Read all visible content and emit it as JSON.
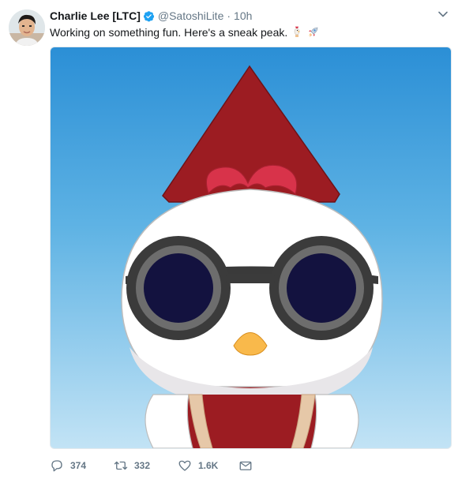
{
  "tweet": {
    "display_name": "Charlie Lee [LTC]",
    "handle": "@SatoshiLite",
    "separator": "·",
    "time": "10h",
    "text": "Working on something fun. Here's a sneak peak.",
    "emojis": [
      "chicken-icon",
      "rocket-icon"
    ]
  },
  "actions": {
    "reply_count": "374",
    "retweet_count": "332",
    "like_count": "1.6K"
  },
  "colors": {
    "verified": "#1da1f2",
    "meta_gray": "#657786",
    "sky_top": "#2b8fd6",
    "sky_bottom": "#c2e3f5",
    "rocket_red": "#9c1c22",
    "comb_red": "#d8334a",
    "beak": "#f9b94b"
  }
}
